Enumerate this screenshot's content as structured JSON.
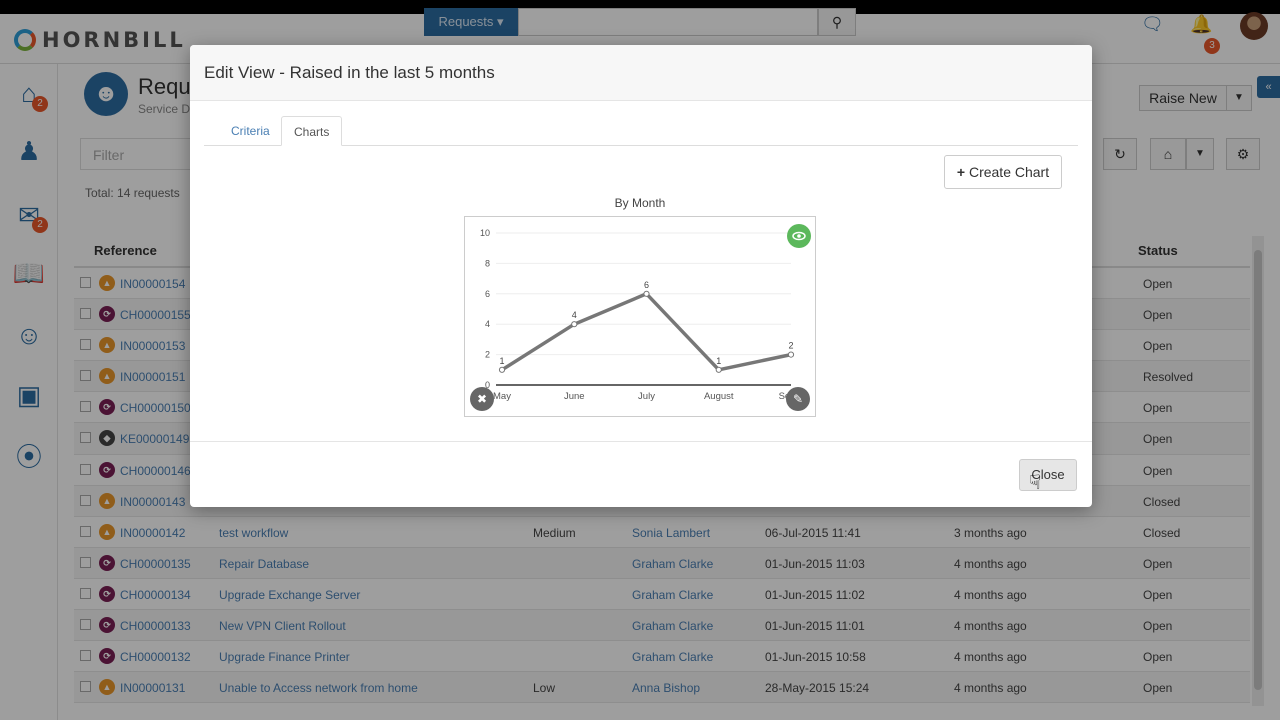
{
  "app": {
    "logo_text": "HORNBILL",
    "search_scope": "Requests ▾",
    "notifications_count": "3"
  },
  "nav": {
    "home_badge": "2",
    "mail_badge": "2"
  },
  "page": {
    "title": "Requ",
    "subtitle": "Service D",
    "raise_new": "Raise New",
    "filter_placeholder": "Filter",
    "total": "Total: 14 requests",
    "columns": {
      "reference": "Reference",
      "status": "Status"
    },
    "rows": [
      {
        "type": "incident",
        "ref": "IN00000154",
        "summary": "",
        "priority": "",
        "customer": "",
        "date": "",
        "ago": "",
        "status": "Open"
      },
      {
        "type": "change",
        "ref": "CH00000155",
        "summary": "",
        "priority": "",
        "customer": "",
        "date": "",
        "ago": "",
        "status": "Open"
      },
      {
        "type": "incident",
        "ref": "IN00000153",
        "summary": "",
        "priority": "",
        "customer": "",
        "date": "",
        "ago": "",
        "status": "Open"
      },
      {
        "type": "incident",
        "ref": "IN00000151",
        "summary": "",
        "priority": "",
        "customer": "",
        "date": "",
        "ago": "",
        "status": "Resolved"
      },
      {
        "type": "change",
        "ref": "CH00000150",
        "summary": "",
        "priority": "",
        "customer": "",
        "date": "",
        "ago": "",
        "status": "Open"
      },
      {
        "type": "known",
        "ref": "KE00000149",
        "summary": "",
        "priority": "",
        "customer": "",
        "date": "",
        "ago": "",
        "status": "Open"
      },
      {
        "type": "change",
        "ref": "CH00000146",
        "summary": "",
        "priority": "",
        "customer": "",
        "date": "",
        "ago": "",
        "status": "Open"
      },
      {
        "type": "incident",
        "ref": "IN00000143",
        "summary": "",
        "priority": "",
        "customer": "",
        "date": "",
        "ago": "",
        "status": "Closed"
      },
      {
        "type": "incident",
        "ref": "IN00000142",
        "summary": "test workflow",
        "priority": "Medium",
        "customer": "Sonia Lambert",
        "date": "06-Jul-2015 11:41",
        "ago": "3 months ago",
        "status": "Closed"
      },
      {
        "type": "change",
        "ref": "CH00000135",
        "summary": "Repair Database",
        "priority": "",
        "customer": "Graham Clarke",
        "date": "01-Jun-2015 11:03",
        "ago": "4 months ago",
        "status": "Open"
      },
      {
        "type": "change",
        "ref": "CH00000134",
        "summary": "Upgrade Exchange Server",
        "priority": "",
        "customer": "Graham Clarke",
        "date": "01-Jun-2015 11:02",
        "ago": "4 months ago",
        "status": "Open"
      },
      {
        "type": "change",
        "ref": "CH00000133",
        "summary": "New VPN Client Rollout",
        "priority": "",
        "customer": "Graham Clarke",
        "date": "01-Jun-2015 11:01",
        "ago": "4 months ago",
        "status": "Open"
      },
      {
        "type": "change",
        "ref": "CH00000132",
        "summary": "Upgrade Finance Printer",
        "priority": "",
        "customer": "Graham Clarke",
        "date": "01-Jun-2015 10:58",
        "ago": "4 months ago",
        "status": "Open"
      },
      {
        "type": "incident",
        "ref": "IN00000131",
        "summary": "Unable to Access network from home",
        "priority": "Low",
        "customer": "Anna Bishop",
        "date": "28-May-2015 15:24",
        "ago": "4 months ago",
        "status": "Open"
      }
    ]
  },
  "modal": {
    "title": "Edit View - Raised in the last 5 months",
    "tabs": [
      "Criteria",
      "Charts"
    ],
    "active_tab": "Charts",
    "create_chart": "Create Chart",
    "close": "Close"
  },
  "chart_data": {
    "type": "line",
    "title": "By Month",
    "categories": [
      "May",
      "June",
      "July",
      "August",
      "September"
    ],
    "category_labels_shown": [
      "May",
      "June",
      "July",
      "August",
      "Septe"
    ],
    "values": [
      1,
      4,
      6,
      1,
      2
    ],
    "ylim": [
      0,
      10
    ],
    "yticks": [
      0,
      2,
      4,
      6,
      8,
      10
    ],
    "grid": true,
    "line_color": "#777777"
  },
  "colors": {
    "brand": "#2d6ca2",
    "badge": "#e8572a",
    "incident": "#e8962a",
    "change": "#7a1f54",
    "eye_button": "#5cb85c"
  }
}
